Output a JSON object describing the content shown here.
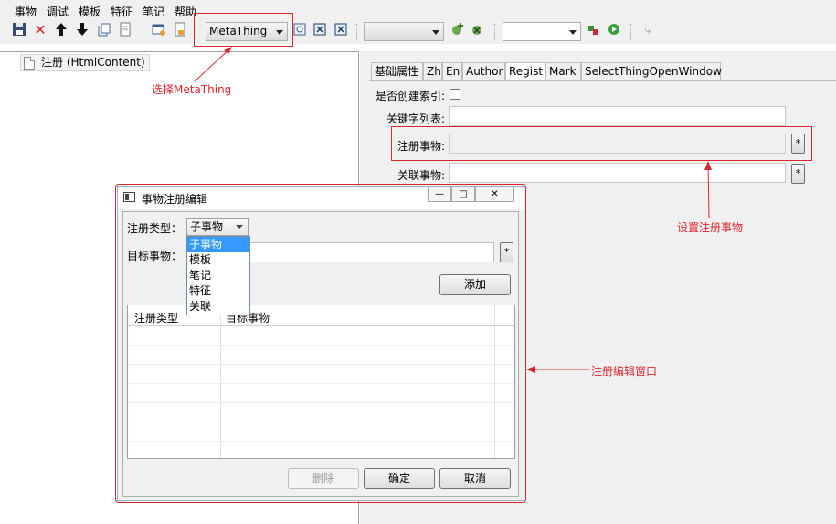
{
  "menu": [
    "事物",
    "调试",
    "模板",
    "特征",
    "笔记",
    "帮助"
  ],
  "toolbar": {
    "type_combo_value": "MetaThing",
    "icons": [
      "save-icon",
      "delete-icon",
      "arrow-up-icon",
      "arrow-down-icon",
      "copy-icon",
      "document-icon",
      "window-icon",
      "note-icon",
      "refresh-icon",
      "close-box-icon",
      "close-box-alt-icon",
      "add-icon",
      "remove-icon",
      "stop-icon",
      "run-icon",
      "pin-icon"
    ]
  },
  "tree": {
    "node_label": "注册 (HtmlContent)"
  },
  "tabs": [
    "基础属性",
    "Zh",
    "En",
    "Author",
    "Regist",
    "Mark",
    "SelectThingOpenWindow"
  ],
  "active_tab": "Regist",
  "props": {
    "index_label": "是否创建索引:",
    "keywords_label": "关键字列表:",
    "register_label": "注册事物:",
    "related_label": "关联事物:",
    "star": "*"
  },
  "annotations": {
    "select_metathing": "选择MetaThing",
    "set_register": "设置注册事物",
    "edit_window": "注册编辑窗口",
    "color": "#d9262e"
  },
  "dialog": {
    "title": "事物注册编辑",
    "type_label": "注册类型：",
    "type_value": "子事物",
    "target_label": "目标事物：",
    "star": "*",
    "add_button": "添加",
    "grid_headers": [
      "注册类型",
      "目标事物"
    ],
    "dropdown_options": [
      "子事物",
      "模板",
      "笔记",
      "特征",
      "关联"
    ],
    "dropdown_selected": "子事物",
    "delete_button": "删除",
    "ok_button": "确定",
    "cancel_button": "取消",
    "win_buttons": [
      "—",
      "□",
      "✕"
    ]
  }
}
